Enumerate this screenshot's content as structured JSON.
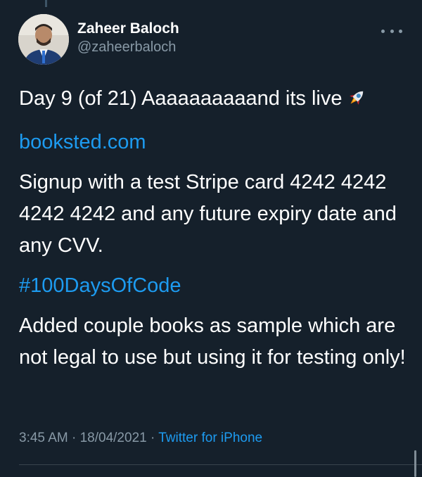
{
  "colors": {
    "background": "#15202b",
    "text": "#ffffff",
    "muted": "#8899a6",
    "link": "#1d9bf0",
    "divider": "#38444d"
  },
  "tweet": {
    "author": {
      "display_name": "Zaheer Baloch",
      "handle": "@zaheerbaloch",
      "avatar_icon": "user-avatar-photo"
    },
    "more_icon": "more-options-icon",
    "line1": "Day 9 (of 21) Aaaaaaaaaand its live",
    "line1_emoji_icon": "rocket-icon",
    "link_url": "booksted.com",
    "paragraph2": "Signup with a test Stripe card  4242 4242 4242 4242 and any future expiry date and any CVV.",
    "hashtag": "#100DaysOfCode",
    "paragraph3": "Added couple books as sample which are not legal to use but using it for testing only!",
    "time": "3:45 AM",
    "date": "18/04/2021",
    "source": "Twitter for iPhone"
  }
}
